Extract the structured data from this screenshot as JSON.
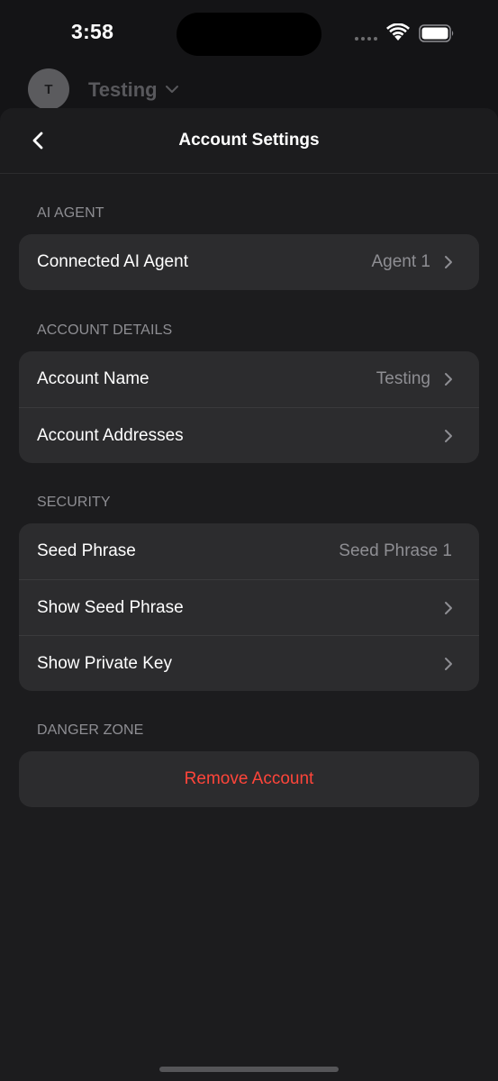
{
  "status_bar": {
    "time": "3:58"
  },
  "background": {
    "avatar_initial": "T",
    "account_name": "Testing"
  },
  "nav": {
    "title": "Account Settings"
  },
  "sections": {
    "ai_agent": {
      "header": "AI AGENT",
      "rows": [
        {
          "label": "Connected AI Agent",
          "value": "Agent 1"
        }
      ]
    },
    "account_details": {
      "header": "ACCOUNT DETAILS",
      "rows": [
        {
          "label": "Account Name",
          "value": "Testing"
        },
        {
          "label": "Account Addresses",
          "value": ""
        }
      ]
    },
    "security": {
      "header": "SECURITY",
      "rows": [
        {
          "label": "Seed Phrase",
          "value": "Seed Phrase 1"
        },
        {
          "label": "Show Seed Phrase",
          "value": ""
        },
        {
          "label": "Show Private Key",
          "value": ""
        }
      ]
    },
    "danger_zone": {
      "header": "DANGER ZONE",
      "remove_label": "Remove Account"
    }
  },
  "colors": {
    "danger": "#ff453a",
    "sheet": "#1c1c1e",
    "row_bg": "#2c2c2e"
  }
}
